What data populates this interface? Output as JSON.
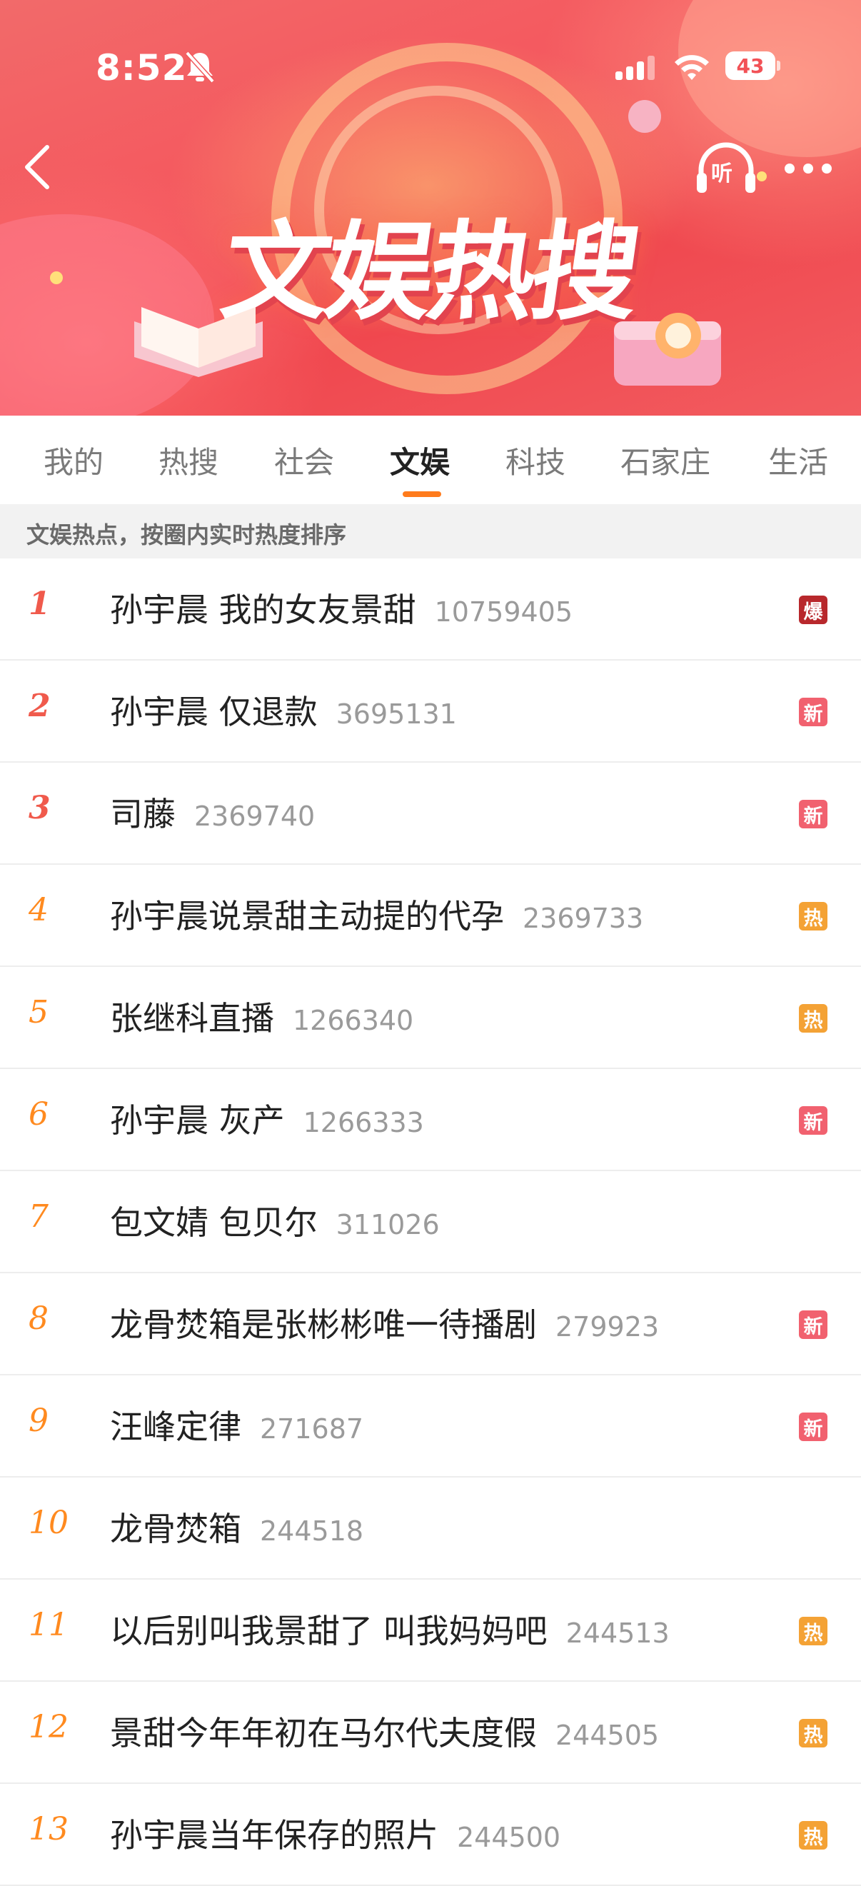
{
  "status_bar": {
    "time": "8:52",
    "battery": "43"
  },
  "header": {
    "banner_title": "文娱热搜",
    "listen_label": "听"
  },
  "tabs": [
    {
      "label": "我的"
    },
    {
      "label": "热搜"
    },
    {
      "label": "社会"
    },
    {
      "label": "文娱",
      "active": true
    },
    {
      "label": "科技"
    },
    {
      "label": "石家庄"
    },
    {
      "label": "生活"
    }
  ],
  "subheader": "文娱热点，按圈内实时热度排序",
  "colors": {
    "accent": "#ff7b1c",
    "badge_bao": "#b8282c",
    "badge_xin": "#f1616f",
    "badge_re": "#f4a235"
  },
  "list": [
    {
      "rank": "1",
      "title": "孙宇晨 我的女友景甜",
      "count": "10759405",
      "badge": "爆",
      "badge_type": "bao"
    },
    {
      "rank": "2",
      "title": "孙宇晨 仅退款",
      "count": "3695131",
      "badge": "新",
      "badge_type": "xin"
    },
    {
      "rank": "3",
      "title": "司藤",
      "count": "2369740",
      "badge": "新",
      "badge_type": "xin"
    },
    {
      "rank": "4",
      "title": "孙宇晨说景甜主动提的代孕",
      "count": "2369733",
      "badge": "热",
      "badge_type": "re"
    },
    {
      "rank": "5",
      "title": "张继科直播",
      "count": "1266340",
      "badge": "热",
      "badge_type": "re"
    },
    {
      "rank": "6",
      "title": "孙宇晨 灰产",
      "count": "1266333",
      "badge": "新",
      "badge_type": "xin"
    },
    {
      "rank": "7",
      "title": "包文婧 包贝尔",
      "count": "311026",
      "badge": "",
      "badge_type": ""
    },
    {
      "rank": "8",
      "title": "龙骨焚箱是张彬彬唯一待播剧",
      "count": "279923",
      "badge": "新",
      "badge_type": "xin"
    },
    {
      "rank": "9",
      "title": "汪峰定律",
      "count": "271687",
      "badge": "新",
      "badge_type": "xin"
    },
    {
      "rank": "10",
      "title": "龙骨焚箱",
      "count": "244518",
      "badge": "",
      "badge_type": ""
    },
    {
      "rank": "11",
      "title": "以后别叫我景甜了 叫我妈妈吧",
      "count": "244513",
      "badge": "热",
      "badge_type": "re"
    },
    {
      "rank": "12",
      "title": "景甜今年年初在马尔代夫度假",
      "count": "244505",
      "badge": "热",
      "badge_type": "re"
    },
    {
      "rank": "13",
      "title": "孙宇晨当年保存的照片",
      "count": "244500",
      "badge": "热",
      "badge_type": "re"
    }
  ]
}
